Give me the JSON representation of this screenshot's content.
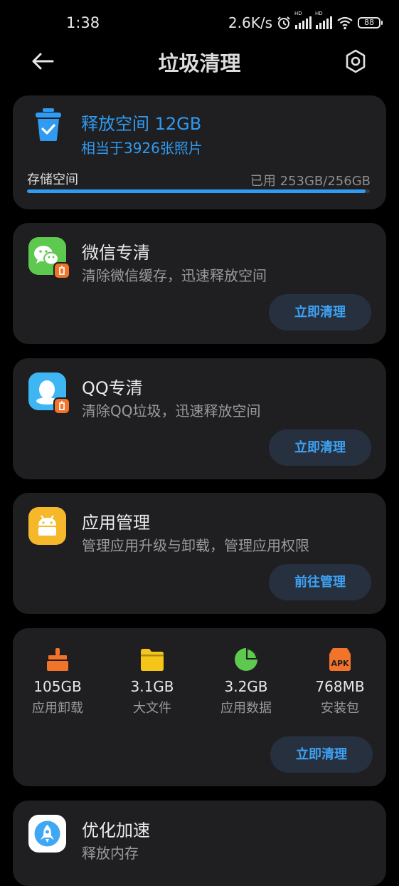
{
  "status_bar": {
    "time": "1:38",
    "speed": "2.6K/s",
    "battery": "88",
    "hd": "HD"
  },
  "header": {
    "title": "垃圾清理"
  },
  "storage": {
    "release_title": "释放空间 12GB",
    "release_subtitle": "相当于3926张照片",
    "label": "存储空间",
    "used_text": "已用 253GB/256GB",
    "used_fraction": 0.988
  },
  "features": [
    {
      "title": "微信专清",
      "desc": "清除微信缓存，迅速释放空间",
      "button": "立即清理"
    },
    {
      "title": "QQ专清",
      "desc": "清除QQ垃圾，迅速释放空间",
      "button": "立即清理"
    },
    {
      "title": "应用管理",
      "desc": "管理应用升级与卸载，管理应用权限",
      "button": "前往管理"
    }
  ],
  "stats": {
    "items": [
      {
        "value": "105GB",
        "label": "应用卸载",
        "icon": "brush-icon"
      },
      {
        "value": "3.1GB",
        "label": "大文件",
        "icon": "folder-icon"
      },
      {
        "value": "3.2GB",
        "label": "应用数据",
        "icon": "pie-icon"
      },
      {
        "value": "768MB",
        "label": "安装包",
        "icon": "apk-icon",
        "icon_text": "APK"
      }
    ],
    "button": "立即清理"
  },
  "optimize": {
    "title": "优化加速",
    "desc": "释放内存"
  },
  "colors": {
    "accent": "#2f9bf2",
    "card": "#1f1f21",
    "wechat": "#5ec94f",
    "qq": "#3fb6f4",
    "android": "#f5b82b",
    "orange": "#f2732a"
  }
}
